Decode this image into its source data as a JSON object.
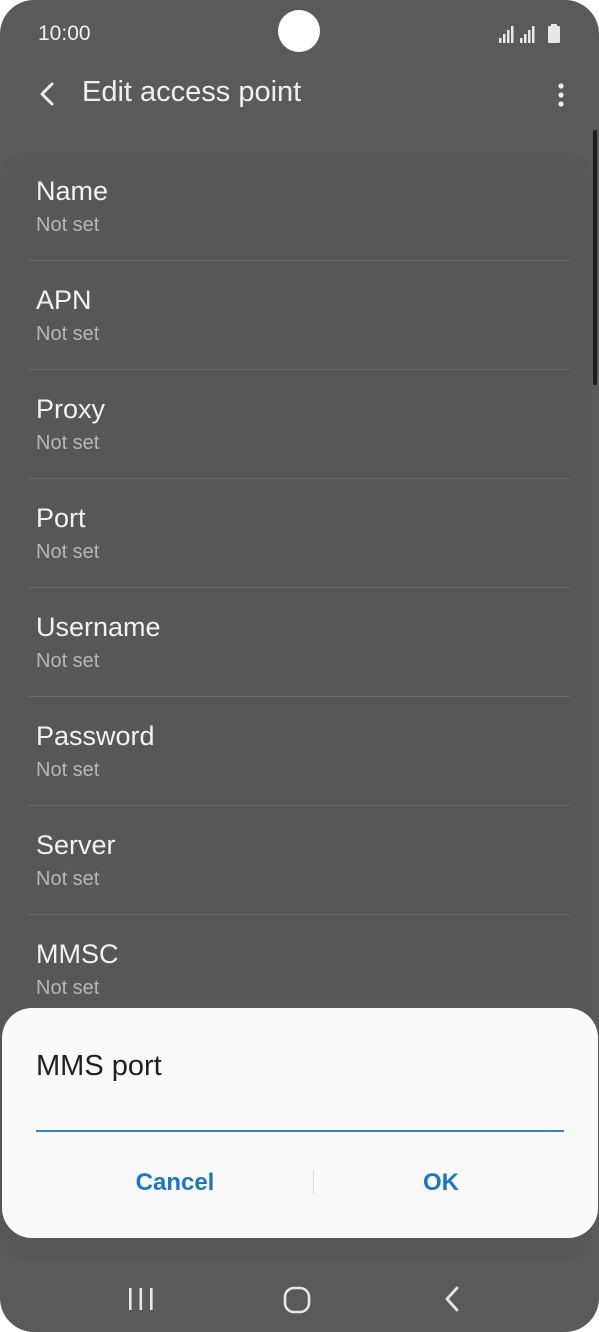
{
  "status_bar": {
    "time": "10:00",
    "icons": [
      "signal-icon",
      "signal-icon",
      "battery-icon"
    ]
  },
  "app_bar": {
    "title": "Edit access point",
    "back_icon": "back-arrow-icon",
    "menu_icon": "more-vert-icon"
  },
  "settings": [
    {
      "label": "Name",
      "value": "Not set"
    },
    {
      "label": "APN",
      "value": "Not set"
    },
    {
      "label": "Proxy",
      "value": "Not set"
    },
    {
      "label": "Port",
      "value": "Not set"
    },
    {
      "label": "Username",
      "value": "Not set"
    },
    {
      "label": "Password",
      "value": "Not set"
    },
    {
      "label": "Server",
      "value": "Not set"
    },
    {
      "label": "MMSC",
      "value": "Not set"
    }
  ],
  "dialog": {
    "title": "MMS port",
    "input_value": "",
    "cancel_label": "Cancel",
    "ok_label": "OK"
  },
  "nav_bar": {
    "recents_icon": "recents-icon",
    "home_icon": "home-icon",
    "back_icon": "nav-back-icon"
  },
  "colors": {
    "accent": "#1b76c3",
    "input_underline": "#2e86c8",
    "overlay_background": "#5a5a5a",
    "dialog_background": "#fafafa"
  }
}
